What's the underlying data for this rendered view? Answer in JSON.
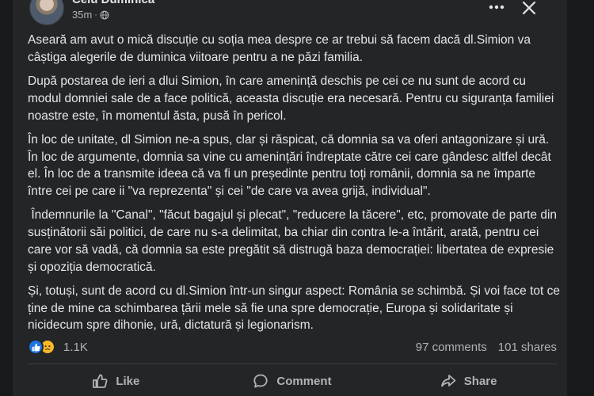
{
  "post": {
    "author": "Celu Duminica",
    "timestamp": "35m",
    "separator": "·",
    "paragraphs": [
      "Aseară am avut o mică discuție cu soția mea despre ce ar trebui să facem dacă dl.Simion va câștiga alegerile de duminica viitoare pentru a ne păzi familia.",
      "După postarea de ieri a dlui Simion, în care amenință deschis pe cei ce nu sunt de acord cu modul domniei sale de a face politică, aceasta discuție era necesară. Pentru cu siguranța familiei noastre este, în momentul ăsta, pusă în pericol.",
      "În loc de unitate, dl Simion ne-a spus, clar și răspicat, că domnia sa va oferi antagonizare și ură. În loc de argumente, domnia sa vine cu amenințări îndreptate către cei care gândesc altfel decât el. În loc de a transmite ideea că va fi un președinte pentru toți românii, domnia sa ne împarte între cei pe care ii \"va reprezenta\" și cei \"de care va avea grijă, individual\".",
      " Îndemnurile la \"Canal\", \"făcut bagajul și plecat\", \"reducere la tăcere\", etc, promovate de parte din susținătorii săi politici, de care nu s-a delimitat, ba chiar din contra le-a întărit, arată, pentru cei care vor să vadă, că domnia sa este pregătit să distrugă baza democrației: libertatea de expresie și opoziția democratică.",
      "Și, totuși, sunt de acord cu dl.Simion într-un singur aspect: România se schimbă. Și voi face tot ce ține de mine ca schimbarea țării mele să fie una spre democrație, Europa și solidaritate și nicidecum spre dihonie, ură, dictatură și legionarism."
    ]
  },
  "reactions": {
    "icons": [
      "like-icon",
      "sad-icon"
    ],
    "count": "1.1K",
    "comments": "97 comments",
    "shares": "101 shares"
  },
  "actions": {
    "like": "Like",
    "comment": "Comment",
    "share": "Share"
  },
  "colors": {
    "background": "#242526",
    "page": "#18191a",
    "text": "#e4e6eb",
    "secondary_text": "#b0b3b8",
    "like_blue": "#1b74e4",
    "sad_yellow": "#f7b928"
  }
}
